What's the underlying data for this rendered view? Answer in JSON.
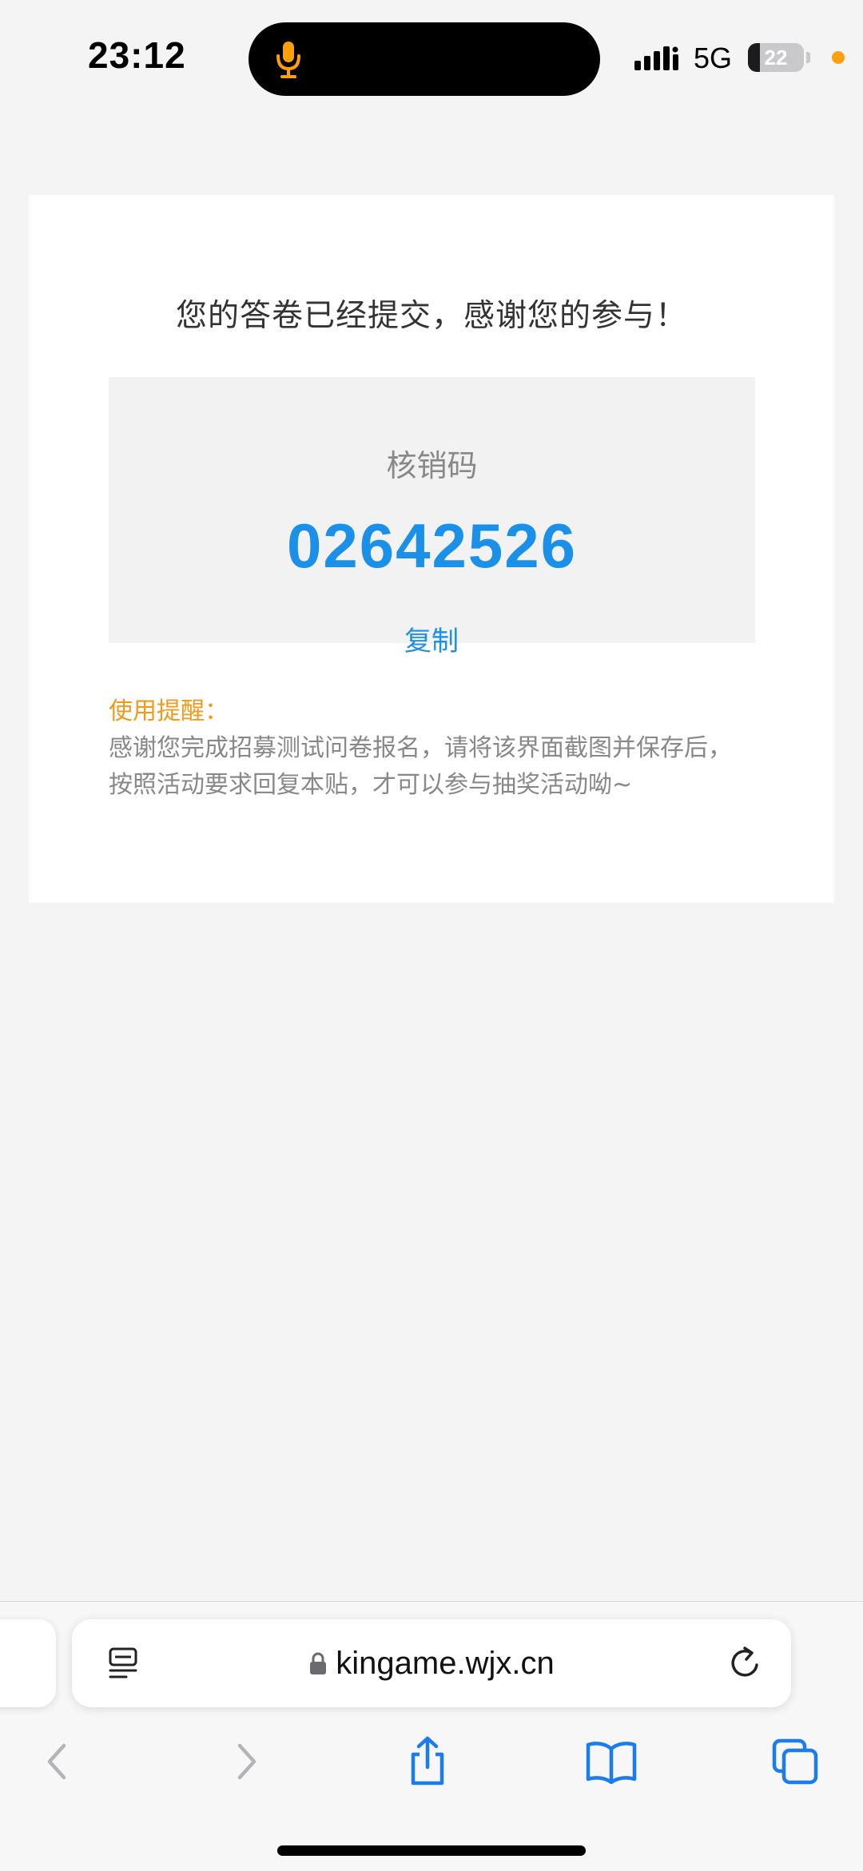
{
  "status_bar": {
    "time": "23:12",
    "network": "5G",
    "battery_level": "22",
    "battery_fraction": 0.22,
    "mic_icon": "microphone-icon",
    "signal_icon": "cellular-signal-icon"
  },
  "page": {
    "title": "您的答卷已经提交，感谢您的参与！",
    "code_label": "核销码",
    "code_value": "02642526",
    "copy_label": "复制",
    "notice_title": "使用提醒：",
    "notice_lines": [
      "感谢您完成招募测试问卷报名，请将该界面截图并保存后，",
      "按照活动要求回复本贴，才可以参与抽奖活动呦~"
    ]
  },
  "browser": {
    "url": "kingame.wjx.cn",
    "icons": {
      "reader": "page-menu-icon",
      "lock": "lock-icon",
      "reload": "reload-icon",
      "back": "chevron-left-icon",
      "forward": "chevron-right-icon",
      "share": "share-icon",
      "bookmarks": "book-icon",
      "tabs": "tabs-icon"
    }
  },
  "colors": {
    "accent_blue": "#1a90e8",
    "notice_orange": "#f09a1b",
    "mic_orange": "#ff9f0a",
    "toolbar_blue": "#1a7cf0",
    "disabled_gray": "#b4b4b8"
  }
}
